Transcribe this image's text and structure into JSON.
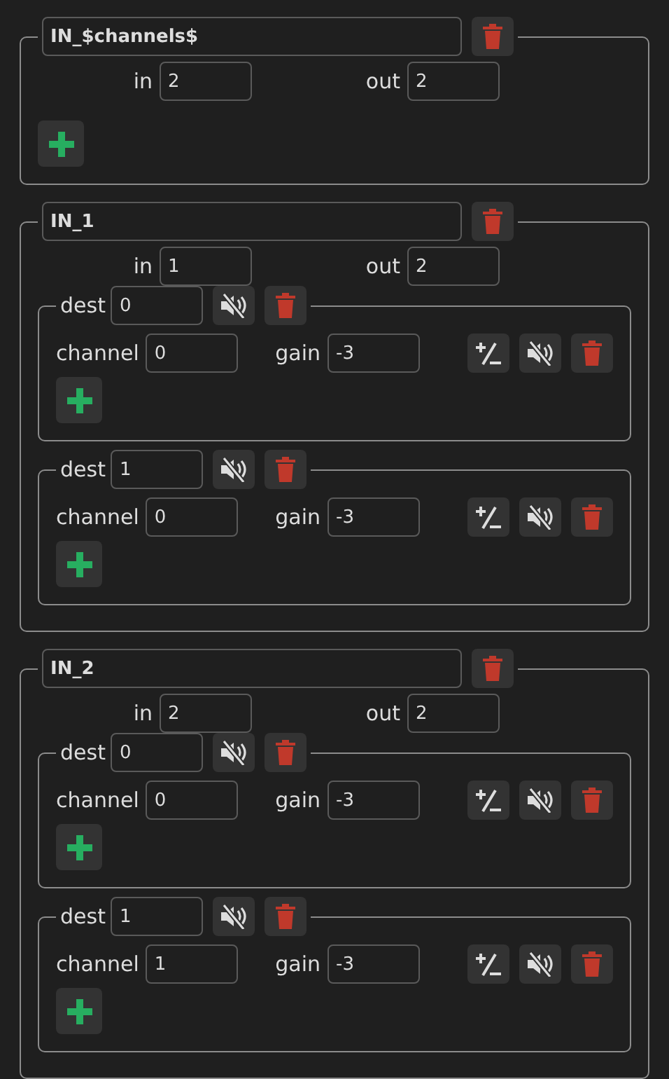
{
  "inputs": [
    {
      "name": "IN_$channels$",
      "in": {
        "label": "in",
        "value": "2"
      },
      "out": {
        "label": "out",
        "value": "2"
      }
    },
    {
      "name": "IN_1",
      "in": {
        "label": "in",
        "value": "1"
      },
      "out": {
        "label": "out",
        "value": "2"
      },
      "dests": [
        {
          "label": "dest",
          "value": "0",
          "routes": [
            {
              "channel": {
                "label": "channel",
                "value": "0"
              },
              "gain": {
                "label": "gain",
                "value": "-3"
              }
            }
          ]
        },
        {
          "label": "dest",
          "value": "1",
          "routes": [
            {
              "channel": {
                "label": "channel",
                "value": "0"
              },
              "gain": {
                "label": "gain",
                "value": "-3"
              }
            }
          ]
        }
      ]
    },
    {
      "name": "IN_2",
      "in": {
        "label": "in",
        "value": "2"
      },
      "out": {
        "label": "out",
        "value": "2"
      },
      "dests": [
        {
          "label": "dest",
          "value": "0",
          "routes": [
            {
              "channel": {
                "label": "channel",
                "value": "0"
              },
              "gain": {
                "label": "gain",
                "value": "-3"
              }
            }
          ]
        },
        {
          "label": "dest",
          "value": "1",
          "routes": [
            {
              "channel": {
                "label": "channel",
                "value": "1"
              },
              "gain": {
                "label": "gain",
                "value": "-3"
              }
            }
          ]
        }
      ]
    }
  ]
}
